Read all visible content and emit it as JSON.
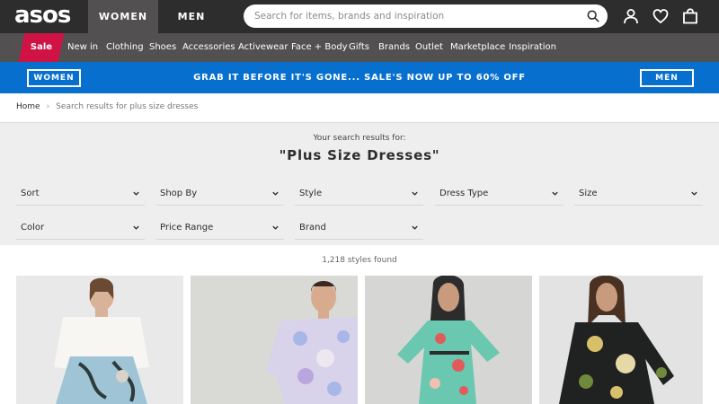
{
  "header": {
    "logo": "asos",
    "tabs": [
      {
        "label": "WOMEN",
        "active": true
      },
      {
        "label": "MEN",
        "active": false
      }
    ],
    "search_placeholder": "Search for items, brands and inspiration",
    "icons": [
      "search-icon",
      "account-icon",
      "heart-icon",
      "bag-icon"
    ]
  },
  "nav": {
    "sale_label": "Sale",
    "items": [
      "New in",
      "Clothing",
      "Shoes",
      "Accessories",
      "Activewear",
      "Face + Body",
      "Gifts",
      "Brands",
      "Outlet",
      "Marketplace",
      "Inspiration"
    ]
  },
  "promo": {
    "left_button": "WOMEN",
    "text": "GRAB IT BEFORE IT'S GONE... SALE'S NOW UP TO 60% OFF",
    "right_button": "MEN"
  },
  "breadcrumb": {
    "home": "Home",
    "separator": "›",
    "current": "Search results for plus size dresses"
  },
  "results": {
    "subtitle": "Your search results for:",
    "title": "\"Plus Size Dresses\"",
    "count": "1,218 styles found"
  },
  "filters": [
    "Sort",
    "Shop By",
    "Style",
    "Dress Type",
    "Size",
    "Color",
    "Price Range",
    "Brand"
  ],
  "products": [
    {
      "name": "product-1",
      "palette": [
        "#e9e9e9",
        "#f7f6f2",
        "#9fc4d6",
        "#2f3b3a"
      ]
    },
    {
      "name": "product-2",
      "palette": [
        "#d9dad6",
        "#d8d3ea",
        "#a9b6e8",
        "#ede8ef"
      ]
    },
    {
      "name": "product-3",
      "palette": [
        "#d6d6d4",
        "#6ac7b0",
        "#e25b5b",
        "#2c2c2c"
      ]
    },
    {
      "name": "product-4",
      "palette": [
        "#e3e3e3",
        "#1f2220",
        "#d8c06a",
        "#6f8a3a"
      ]
    }
  ],
  "colors": {
    "header_bg": "#2d2d2d",
    "nav_bg": "#525050",
    "sale_bg": "#d01345",
    "promo_bg": "#0770cf",
    "filter_bg": "#eeeeee"
  }
}
